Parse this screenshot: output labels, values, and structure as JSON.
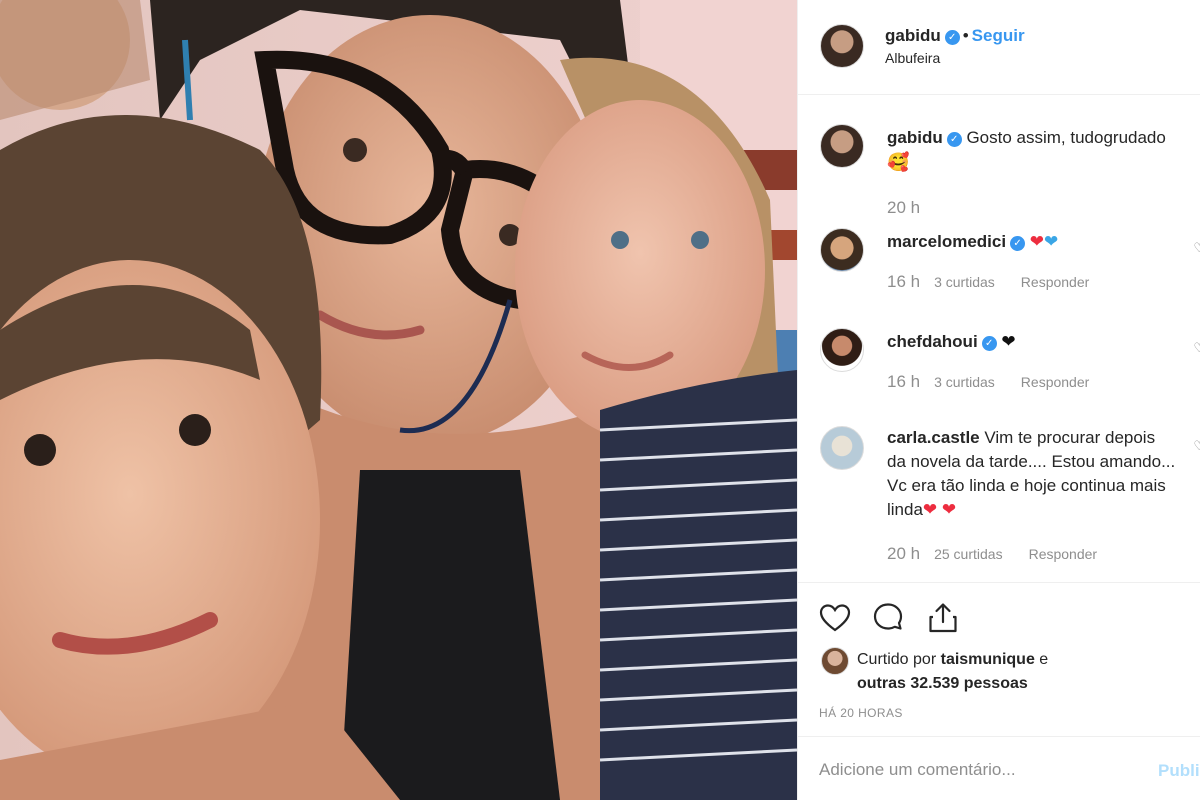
{
  "post": {
    "username": "gabidu",
    "follow_label": "Seguir",
    "location": "Albufeira",
    "verified_icon": "verified-badge-icon"
  },
  "caption": {
    "username": "gabidu",
    "text": "Gosto assim, tudogrudado",
    "emoji": "🥰",
    "time": "20 h"
  },
  "comments": [
    {
      "username": "marcelomedici",
      "text": "",
      "emoji": [
        "❤",
        "❤"
      ],
      "time": "16 h",
      "likes": "3 curtidas",
      "reply": "Responder"
    },
    {
      "username": "chefdahoui",
      "text": "",
      "emoji": [
        "❤"
      ],
      "time": "16 h",
      "likes": "3 curtidas",
      "reply": "Responder"
    },
    {
      "username": "carla.castle",
      "text": "Vim te procurar depois da novela da tarde.... Estou amando... Vc era tão linda e hoje continua mais linda",
      "emoji": [
        "❤",
        "❤"
      ],
      "time": "20 h",
      "likes": "25 curtidas",
      "reply": "Responder"
    }
  ],
  "likes": {
    "prefix": "Curtido por",
    "first_user": "taismunique",
    "conjunction": "e",
    "others": "outras 32.539 pessoas"
  },
  "timestamp": "HÁ 20 HORAS",
  "add_comment": {
    "placeholder": "Adicione um comentário...",
    "publish_label": "Publicar"
  },
  "colors": {
    "accent": "#3897f0",
    "muted": "#8e8e8e",
    "text": "#262626",
    "publish_disabled": "#b2dffc",
    "heart_red": "#ed2d3f",
    "heart_blue": "#3aa6e6"
  }
}
